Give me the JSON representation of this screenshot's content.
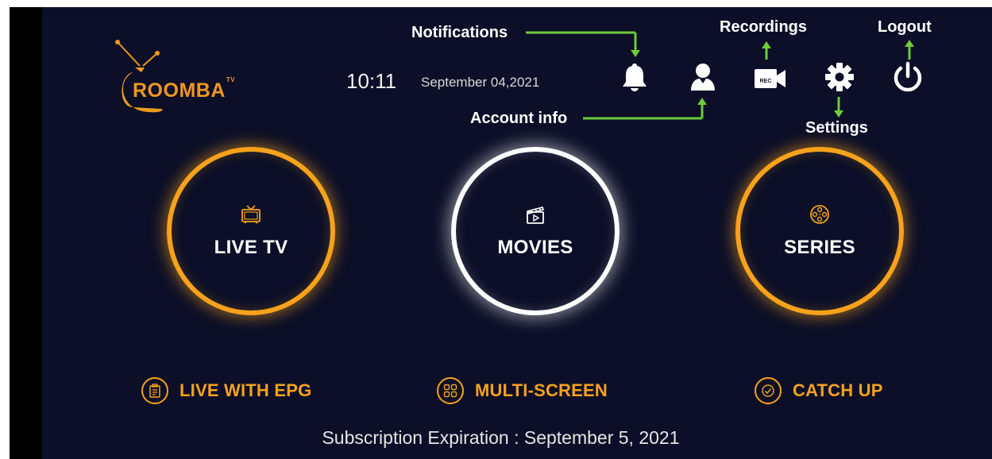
{
  "header": {
    "logo_text": "ROOMBA",
    "logo_tv": "TV",
    "time": "10:11",
    "date": "September 04,2021"
  },
  "top_icons": [
    {
      "name": "bell-icon",
      "label": "Notifications"
    },
    {
      "name": "user-icon",
      "label": "Account info"
    },
    {
      "name": "camera-icon",
      "label": "Recordings",
      "rec_text": "REC"
    },
    {
      "name": "gear-icon",
      "label": "Settings"
    },
    {
      "name": "power-icon",
      "label": "Logout"
    }
  ],
  "annotations": {
    "notifications": "Notifications",
    "account_info": "Account info",
    "recordings": "Recordings",
    "settings": "Settings",
    "logout": "Logout",
    "arrow_color": "#6ecb3c"
  },
  "main_tiles": [
    {
      "label": "LIVE TV",
      "icon": "tv-icon",
      "ring": "orange"
    },
    {
      "label": "MOVIES",
      "icon": "clapperboard-icon",
      "ring": "white"
    },
    {
      "label": "SERIES",
      "icon": "film-reel-icon",
      "ring": "orange"
    }
  ],
  "secondary": [
    {
      "label": "LIVE WITH EPG",
      "icon": "clipboard-icon"
    },
    {
      "label": "MULTI-SCREEN",
      "icon": "grid-icon"
    },
    {
      "label": "CATCH UP",
      "icon": "check-circle-icon"
    }
  ],
  "footer": {
    "subscription": "Subscription Expiration : September 5, 2021"
  },
  "colors": {
    "background": "#0c0f27",
    "accent": "#f7a21b",
    "annotation_arrow": "#6ecb3c"
  }
}
